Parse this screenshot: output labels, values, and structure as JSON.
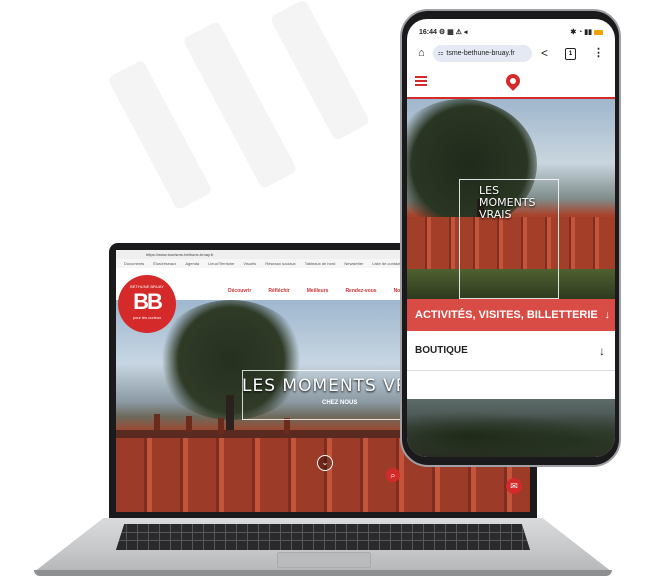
{
  "laptop": {
    "browser_url": "https://www.tourisme-bethune-bruay.fr",
    "bookmarks": [
      "Documents",
      "Élus/réseaux",
      "Agenda",
      "Lieux/Territoire",
      "Visuels",
      "Réseaux sociaux",
      "Tableaux de bord",
      "Newsletter",
      "Liste de contacts"
    ],
    "logo": {
      "top_text": "BÉTHUNE BRUAY",
      "mark": "BB",
      "bottom_text": "pour les curieux"
    },
    "nav_links": [
      "Découvrir",
      "Réfléchir",
      "Meilleurs",
      "Rendez-vous",
      "Nous suivre"
    ],
    "hero_title": "LES MOMENTS VRAIS",
    "hero_subtitle": "CHEZ NOUS",
    "search_glyph": "⌕",
    "scroll_glyph": "⌄",
    "chat_glyph": "✉"
  },
  "phone": {
    "status": {
      "time": "16:44",
      "icons": "⚙ ▦ ⚠ ◂",
      "right": "✱ ◔ ▮▮"
    },
    "address_bar": {
      "home_glyph": "⌂",
      "site_icon": "⚏",
      "url": "tsme-bethune-bruay.fr",
      "share_glyph": "<",
      "tab_count": "1",
      "menu_glyph": "⋮"
    },
    "hero_title_lines": [
      "LES",
      "MOMENTS",
      "VRAIS"
    ],
    "cta_label": "ACTIVITÉS, VISITES, BILLETTERIE",
    "cta_arrow": "↓",
    "row_label": "BOUTIQUE",
    "row_arrow": "↓"
  },
  "colors": {
    "brand_red": "#d42a2a",
    "cta_red": "#d94b45"
  }
}
